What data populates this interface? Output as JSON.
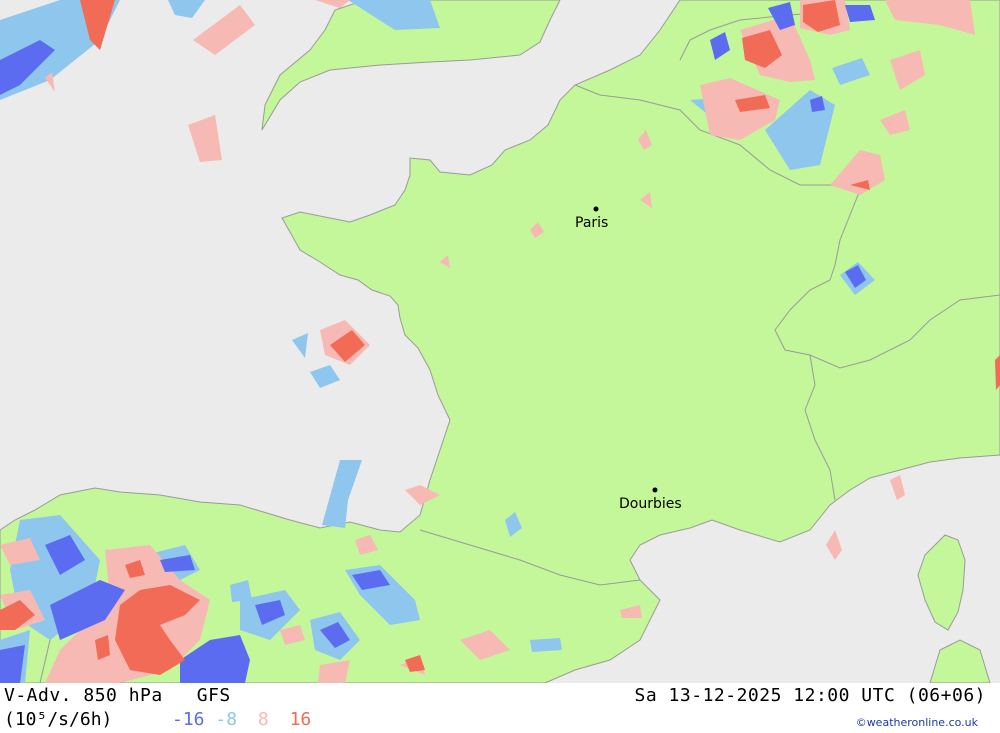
{
  "product": {
    "title": "V-Adv. 850 hPa",
    "model": "GFS",
    "units": "(10⁵/s/6h)",
    "datetime": "Sa 13-12-2025 12:00 UTC (06+06)",
    "credit": "©weatheronline.co.uk"
  },
  "legend": [
    {
      "label": "-16",
      "color": "#5b6cf0"
    },
    {
      "label": "-8",
      "color": "#8ec6ee"
    },
    {
      "label": "8",
      "color": "#f7b9b4"
    },
    {
      "label": "16",
      "color": "#f26b56"
    }
  ],
  "colors": {
    "sea": "#ebebeb",
    "land": "#c4f79a",
    "border": "#9a9a9a",
    "strong_negative": "#5b6cf0",
    "weak_negative": "#8ec6ee",
    "weak_positive": "#f7b9b4",
    "strong_positive": "#f26b56"
  },
  "cities": [
    {
      "name": "Paris"
    },
    {
      "name": "Dourbies"
    }
  ]
}
